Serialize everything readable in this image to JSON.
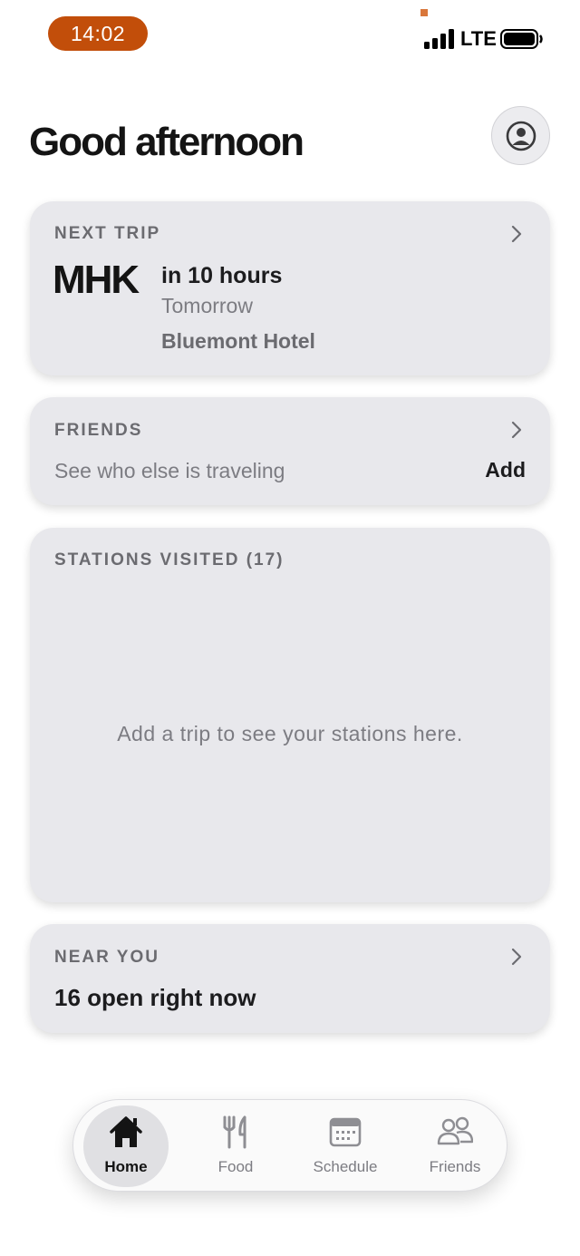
{
  "status_bar": {
    "time": "14:02",
    "network": "LTE",
    "accent_color": "#c24e0a"
  },
  "header": {
    "greeting": "Good afternoon",
    "profile_icon": "person-circle-icon"
  },
  "next_trip": {
    "label": "NEXT TRIP",
    "code": "MHK",
    "when": "in 10 hours",
    "day": "Tomorrow",
    "hotel": "Bluemont Hotel"
  },
  "friends": {
    "label": "FRIENDS",
    "subtitle": "See who else is traveling",
    "action": "Add"
  },
  "stations": {
    "label": "STATIONS VISITED (17)",
    "empty_message": "Add a trip to see your stations here."
  },
  "near_you": {
    "label": "NEAR YOU",
    "summary": "16 open right now"
  },
  "tab_bar": {
    "active": "Home",
    "tabs": [
      {
        "label": "Home",
        "icon": "house-icon"
      },
      {
        "label": "Food",
        "icon": "fork-knife-icon"
      },
      {
        "label": "Schedule",
        "icon": "calendar-icon"
      },
      {
        "label": "Friends",
        "icon": "people-icon"
      }
    ]
  }
}
